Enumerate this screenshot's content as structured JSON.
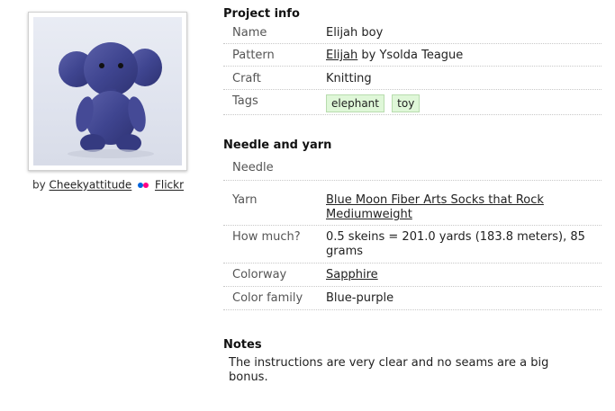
{
  "photo": {
    "credit_prefix": "by",
    "author": "Cheekyattitude",
    "source": "Flickr",
    "colors": {
      "dot_blue": "#0063dc",
      "dot_pink": "#ff0084"
    }
  },
  "project_info": {
    "title": "Project info",
    "name_label": "Name",
    "name_value": "Elijah boy",
    "pattern_label": "Pattern",
    "pattern_link": "Elijah",
    "pattern_by": "by Ysolda Teague",
    "craft_label": "Craft",
    "craft_value": "Knitting",
    "tags_label": "Tags",
    "tags": [
      "elephant",
      "toy"
    ]
  },
  "needle_yarn": {
    "title": "Needle and yarn",
    "needle_label": "Needle",
    "needle_value": "",
    "yarn_label": "Yarn",
    "yarn_link": "Blue Moon Fiber Arts Socks that Rock Mediumweight",
    "how_much_label": "How much?",
    "how_much_value": "0.5 skeins = 201.0 yards (183.8 meters), 85 grams",
    "colorway_label": "Colorway",
    "colorway_link": "Sapphire",
    "color_family_label": "Color family",
    "color_family_value": "Blue-purple"
  },
  "notes": {
    "title": "Notes",
    "text": "The instructions are very clear and no seams are a big bonus."
  }
}
